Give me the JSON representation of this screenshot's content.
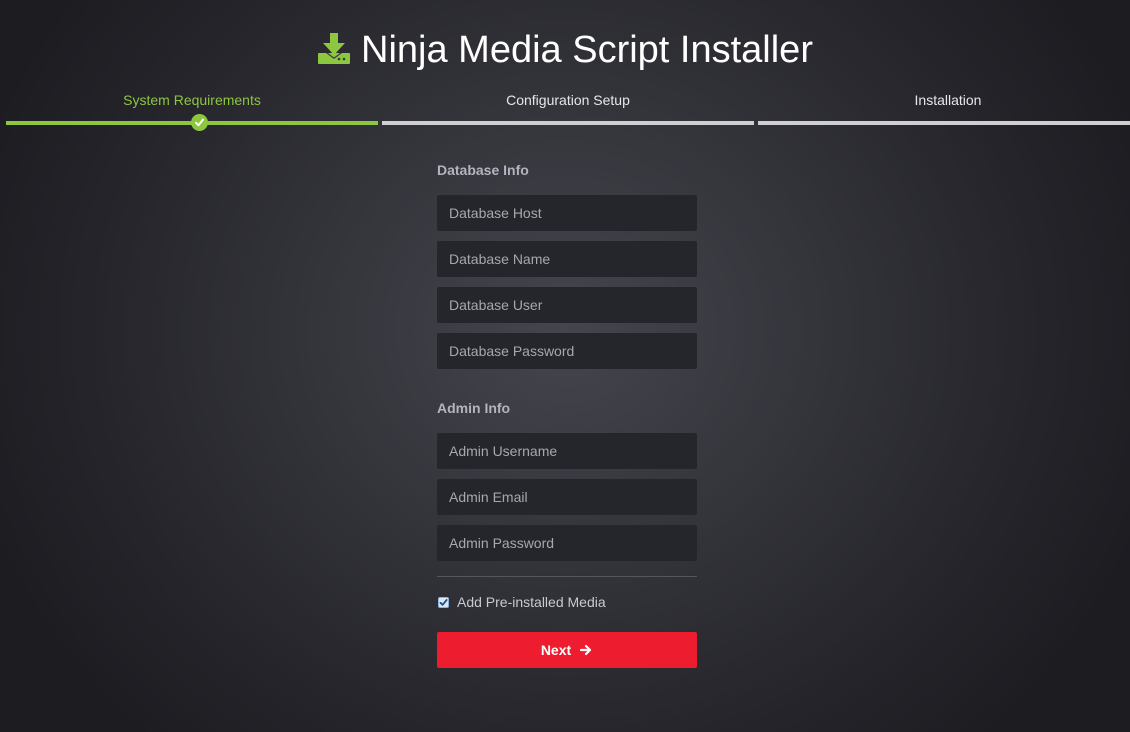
{
  "header": {
    "title": "Ninja Media Script Installer",
    "icon": "download-tray-icon",
    "icon_color": "#8dc63f"
  },
  "steps": [
    {
      "label": "System Requirements",
      "state": "completed"
    },
    {
      "label": "Configuration Setup",
      "state": "pending"
    },
    {
      "label": "Installation",
      "state": "pending"
    }
  ],
  "colors": {
    "accent_green": "#8dc63f",
    "button_red": "#ed1c2e",
    "field_bg": "#25252c"
  },
  "database": {
    "title": "Database Info",
    "host_placeholder": "Database Host",
    "name_placeholder": "Database Name",
    "user_placeholder": "Database User",
    "password_placeholder": "Database Password"
  },
  "admin": {
    "title": "Admin Info",
    "username_placeholder": "Admin Username",
    "email_placeholder": "Admin Email",
    "password_placeholder": "Admin Password"
  },
  "options": {
    "preinstalled_label": "Add Pre-installed Media",
    "preinstalled_checked": true
  },
  "actions": {
    "next_label": "Next",
    "next_icon": "arrow-right-icon"
  }
}
